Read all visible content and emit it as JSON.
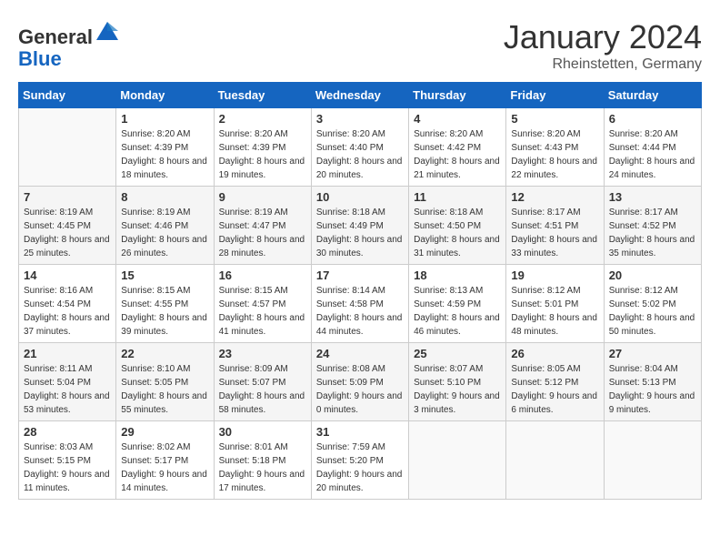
{
  "header": {
    "logo_general": "General",
    "logo_blue": "Blue",
    "month": "January 2024",
    "location": "Rheinstetten, Germany"
  },
  "weekdays": [
    "Sunday",
    "Monday",
    "Tuesday",
    "Wednesday",
    "Thursday",
    "Friday",
    "Saturday"
  ],
  "weeks": [
    {
      "alt": false,
      "days": [
        {
          "num": "",
          "info": ""
        },
        {
          "num": "1",
          "info": "Sunrise: 8:20 AM\nSunset: 4:39 PM\nDaylight: 8 hours\nand 18 minutes."
        },
        {
          "num": "2",
          "info": "Sunrise: 8:20 AM\nSunset: 4:39 PM\nDaylight: 8 hours\nand 19 minutes."
        },
        {
          "num": "3",
          "info": "Sunrise: 8:20 AM\nSunset: 4:40 PM\nDaylight: 8 hours\nand 20 minutes."
        },
        {
          "num": "4",
          "info": "Sunrise: 8:20 AM\nSunset: 4:42 PM\nDaylight: 8 hours\nand 21 minutes."
        },
        {
          "num": "5",
          "info": "Sunrise: 8:20 AM\nSunset: 4:43 PM\nDaylight: 8 hours\nand 22 minutes."
        },
        {
          "num": "6",
          "info": "Sunrise: 8:20 AM\nSunset: 4:44 PM\nDaylight: 8 hours\nand 24 minutes."
        }
      ]
    },
    {
      "alt": true,
      "days": [
        {
          "num": "7",
          "info": "Sunrise: 8:19 AM\nSunset: 4:45 PM\nDaylight: 8 hours\nand 25 minutes."
        },
        {
          "num": "8",
          "info": "Sunrise: 8:19 AM\nSunset: 4:46 PM\nDaylight: 8 hours\nand 26 minutes."
        },
        {
          "num": "9",
          "info": "Sunrise: 8:19 AM\nSunset: 4:47 PM\nDaylight: 8 hours\nand 28 minutes."
        },
        {
          "num": "10",
          "info": "Sunrise: 8:18 AM\nSunset: 4:49 PM\nDaylight: 8 hours\nand 30 minutes."
        },
        {
          "num": "11",
          "info": "Sunrise: 8:18 AM\nSunset: 4:50 PM\nDaylight: 8 hours\nand 31 minutes."
        },
        {
          "num": "12",
          "info": "Sunrise: 8:17 AM\nSunset: 4:51 PM\nDaylight: 8 hours\nand 33 minutes."
        },
        {
          "num": "13",
          "info": "Sunrise: 8:17 AM\nSunset: 4:52 PM\nDaylight: 8 hours\nand 35 minutes."
        }
      ]
    },
    {
      "alt": false,
      "days": [
        {
          "num": "14",
          "info": "Sunrise: 8:16 AM\nSunset: 4:54 PM\nDaylight: 8 hours\nand 37 minutes."
        },
        {
          "num": "15",
          "info": "Sunrise: 8:15 AM\nSunset: 4:55 PM\nDaylight: 8 hours\nand 39 minutes."
        },
        {
          "num": "16",
          "info": "Sunrise: 8:15 AM\nSunset: 4:57 PM\nDaylight: 8 hours\nand 41 minutes."
        },
        {
          "num": "17",
          "info": "Sunrise: 8:14 AM\nSunset: 4:58 PM\nDaylight: 8 hours\nand 44 minutes."
        },
        {
          "num": "18",
          "info": "Sunrise: 8:13 AM\nSunset: 4:59 PM\nDaylight: 8 hours\nand 46 minutes."
        },
        {
          "num": "19",
          "info": "Sunrise: 8:12 AM\nSunset: 5:01 PM\nDaylight: 8 hours\nand 48 minutes."
        },
        {
          "num": "20",
          "info": "Sunrise: 8:12 AM\nSunset: 5:02 PM\nDaylight: 8 hours\nand 50 minutes."
        }
      ]
    },
    {
      "alt": true,
      "days": [
        {
          "num": "21",
          "info": "Sunrise: 8:11 AM\nSunset: 5:04 PM\nDaylight: 8 hours\nand 53 minutes."
        },
        {
          "num": "22",
          "info": "Sunrise: 8:10 AM\nSunset: 5:05 PM\nDaylight: 8 hours\nand 55 minutes."
        },
        {
          "num": "23",
          "info": "Sunrise: 8:09 AM\nSunset: 5:07 PM\nDaylight: 8 hours\nand 58 minutes."
        },
        {
          "num": "24",
          "info": "Sunrise: 8:08 AM\nSunset: 5:09 PM\nDaylight: 9 hours\nand 0 minutes."
        },
        {
          "num": "25",
          "info": "Sunrise: 8:07 AM\nSunset: 5:10 PM\nDaylight: 9 hours\nand 3 minutes."
        },
        {
          "num": "26",
          "info": "Sunrise: 8:05 AM\nSunset: 5:12 PM\nDaylight: 9 hours\nand 6 minutes."
        },
        {
          "num": "27",
          "info": "Sunrise: 8:04 AM\nSunset: 5:13 PM\nDaylight: 9 hours\nand 9 minutes."
        }
      ]
    },
    {
      "alt": false,
      "days": [
        {
          "num": "28",
          "info": "Sunrise: 8:03 AM\nSunset: 5:15 PM\nDaylight: 9 hours\nand 11 minutes."
        },
        {
          "num": "29",
          "info": "Sunrise: 8:02 AM\nSunset: 5:17 PM\nDaylight: 9 hours\nand 14 minutes."
        },
        {
          "num": "30",
          "info": "Sunrise: 8:01 AM\nSunset: 5:18 PM\nDaylight: 9 hours\nand 17 minutes."
        },
        {
          "num": "31",
          "info": "Sunrise: 7:59 AM\nSunset: 5:20 PM\nDaylight: 9 hours\nand 20 minutes."
        },
        {
          "num": "",
          "info": ""
        },
        {
          "num": "",
          "info": ""
        },
        {
          "num": "",
          "info": ""
        }
      ]
    }
  ]
}
